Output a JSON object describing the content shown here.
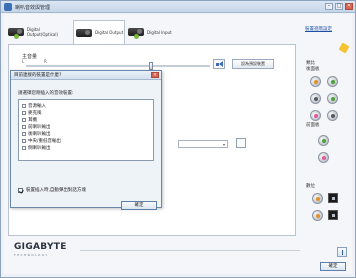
{
  "window": {
    "title": "喇叭音效與管理",
    "min_label": "–",
    "max_label": "□",
    "close_label": "✕"
  },
  "tabs": [
    {
      "label": "Digital Output(Optical)"
    },
    {
      "label": "Digital Output"
    },
    {
      "label": "Digital Input"
    }
  ],
  "volume": {
    "label": "主音量",
    "left": "L",
    "right": "R",
    "set_default_label": "設為預設裝置",
    "level_fraction": 0.68
  },
  "dialog": {
    "title": "目前連接的裝置是什麼?",
    "close_label": "✕",
    "prompt": "請選擇您剛插入的音效裝置:",
    "options": [
      {
        "label": "音源輸入"
      },
      {
        "label": "麥克風"
      },
      {
        "label": "耳機"
      },
      {
        "label": "前喇叭輸出"
      },
      {
        "label": "後喇叭輸出"
      },
      {
        "label": "中央/重低音輸出"
      },
      {
        "label": "側喇叭輸出"
      }
    ],
    "auto_popup_label": "裝置插入時,自動彈出對話方塊",
    "ok_label": "確定"
  },
  "right_panel": {
    "advanced_link": "裝置進階設定",
    "output_label": "類比",
    "rear_label": "後面板",
    "front_label": "前面板",
    "digital_label": "數位"
  },
  "brand": {
    "name": "GIGABYTE",
    "tag": "TECHNOLOGY"
  },
  "footer": {
    "ok_label": "確定"
  }
}
